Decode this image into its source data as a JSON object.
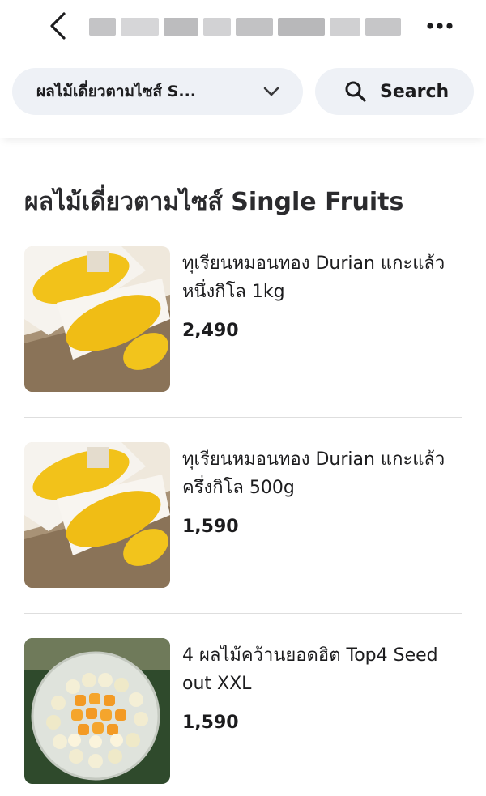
{
  "header": {
    "title_obscured": true,
    "back_icon": "chevron-left-icon",
    "more_icon": "more-horizontal-icon"
  },
  "filters": {
    "category_label": "ผลไม้เดี่ยวตามไซส์ S...",
    "category_icon": "chevron-down-icon",
    "search_label": "Search",
    "search_icon": "search-icon"
  },
  "section": {
    "title": "ผลไม้เดี่ยวตามไซส์ Single Fruits"
  },
  "items": [
    {
      "name": "ทุเรียนหมอนทอง Durian แกะแล้วหนึ่งกิโล 1kg",
      "price": "2,490",
      "image": "durian-box-photo"
    },
    {
      "name": "ทุเรียนหมอนทอง Durian แกะแล้วครึ่งกิโล 500g",
      "price": "1,590",
      "image": "durian-box-photo"
    },
    {
      "name": "4 ผลไม้คว้านยอดฮิต Top4 Seed out XXL",
      "price": "1,590",
      "image": "mixed-fruit-tray-photo"
    }
  ],
  "colors": {
    "pill_background": "#eef1f6",
    "text_primary": "#1c1c1e",
    "divider": "#dedede"
  }
}
